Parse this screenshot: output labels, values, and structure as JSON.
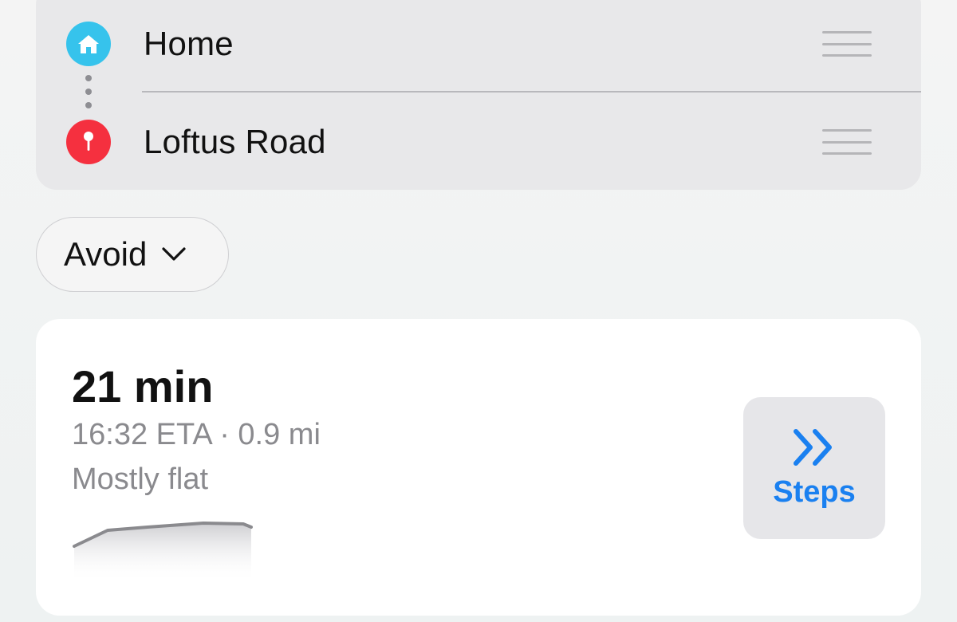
{
  "waypoints": {
    "items": [
      {
        "label": "Home",
        "icon": "house-icon",
        "color": "#36c3ec"
      },
      {
        "label": "Loftus Road",
        "icon": "map-pin-icon",
        "color": "#f5303f"
      }
    ]
  },
  "avoid": {
    "label": "Avoid",
    "icon": "chevron-down-icon"
  },
  "route": {
    "duration": "21 min",
    "eta_distance": "16:32 ETA · 0.9 mi",
    "terrain": "Mostly flat",
    "steps_label": "Steps",
    "steps_icon": "double-chevron-right-icon",
    "accent": "#1a80f0"
  }
}
